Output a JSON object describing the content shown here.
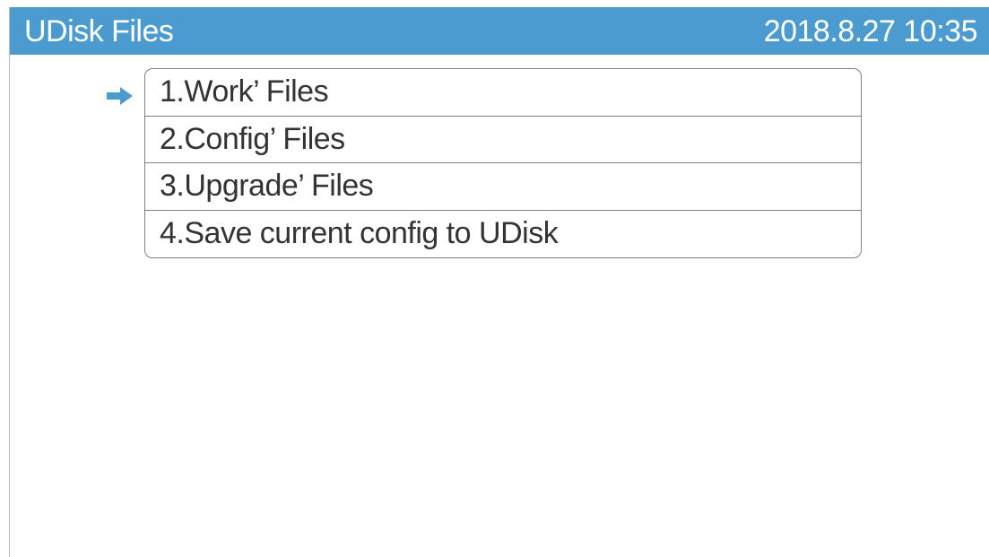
{
  "header": {
    "title": "UDisk Files",
    "datetime": "2018.8.27  10:35",
    "background_color": "#4b9bd0"
  },
  "menu": {
    "selected_index": 0,
    "selector_icon": "right-arrow-icon",
    "items": [
      {
        "label": "1.Work’ Files"
      },
      {
        "label": "2.Config’ Files"
      },
      {
        "label": "3.Upgrade’ Files"
      },
      {
        "label": "4.Save current config to UDisk"
      }
    ]
  }
}
